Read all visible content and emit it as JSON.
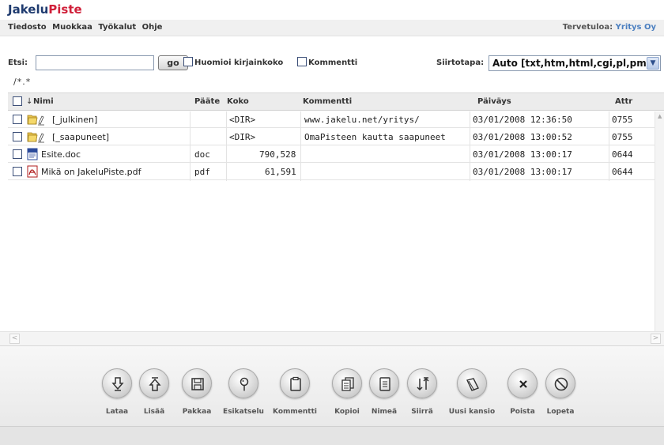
{
  "app": {
    "title_part1": "Jakelu",
    "title_part2": "Piste",
    "brand_dark": "#1f3b6f",
    "brand_red": "#d0203a"
  },
  "menu": {
    "items": [
      "Tiedosto",
      "Muokkaa",
      "Työkalut",
      "Ohje"
    ]
  },
  "welcome": {
    "label": "Tervetuloa:",
    "user": "Yritys Oy"
  },
  "search": {
    "label": "Etsi:",
    "value": "",
    "go_label": "go",
    "case_label": "Huomioi kirjainkoko",
    "comment_label": "Kommentti",
    "transfer_label": "Siirtotapa:",
    "transfer_value": "Auto [txt,htm,html,cgi,pl,pm]"
  },
  "path": "/*.*",
  "columns": {
    "sort_icon": "↓",
    "name": "Nimi",
    "ext": "Pääte",
    "size": "Koko",
    "comment": "Kommentti",
    "date": "Päiväys",
    "attr": "Attr"
  },
  "files": [
    {
      "icon": "folder-open-icon",
      "name": "[_julkinen]",
      "ext": "",
      "size": "<DIR>",
      "comment": "www.jakelu.net/yritys/",
      "date": "03/01/2008 12:36:50",
      "attr": "0755"
    },
    {
      "icon": "folder-open-icon",
      "name": "[_saapuneet]",
      "ext": "",
      "size": "<DIR>",
      "comment": "OmaPisteen kautta saapuneet",
      "date": "03/01/2008 13:00:52",
      "attr": "0755"
    },
    {
      "icon": "word-document-icon",
      "name": "Esite.doc",
      "ext": "doc",
      "size": "790,528",
      "comment": "",
      "date": "03/01/2008 13:00:17",
      "attr": "0644"
    },
    {
      "icon": "pdf-document-icon",
      "name": "Mikä on JakeluPiste.pdf",
      "ext": "pdf",
      "size": "61,591",
      "comment": "",
      "date": "03/01/2008 13:00:17",
      "attr": "0644"
    }
  ],
  "toolbar": {
    "buttons": [
      {
        "label": "Lataa",
        "icon": "download-icon"
      },
      {
        "label": "Lisää",
        "icon": "upload-icon"
      },
      {
        "label": "Pakkaa",
        "icon": "save-icon"
      },
      {
        "label": "Esikatselu",
        "icon": "preview-pin-icon"
      },
      {
        "label": "Kommentti",
        "icon": "clipboard-icon"
      },
      {
        "label": "Kopioi",
        "icon": "copy-icon"
      },
      {
        "label": "Nimeä",
        "icon": "rename-icon"
      },
      {
        "label": "Siirrä",
        "icon": "move-icon"
      },
      {
        "label": "Uusi kansio",
        "icon": "new-folder-icon"
      },
      {
        "label": "Poista",
        "icon": "delete-icon"
      },
      {
        "label": "Lopeta",
        "icon": "stop-icon"
      }
    ]
  }
}
